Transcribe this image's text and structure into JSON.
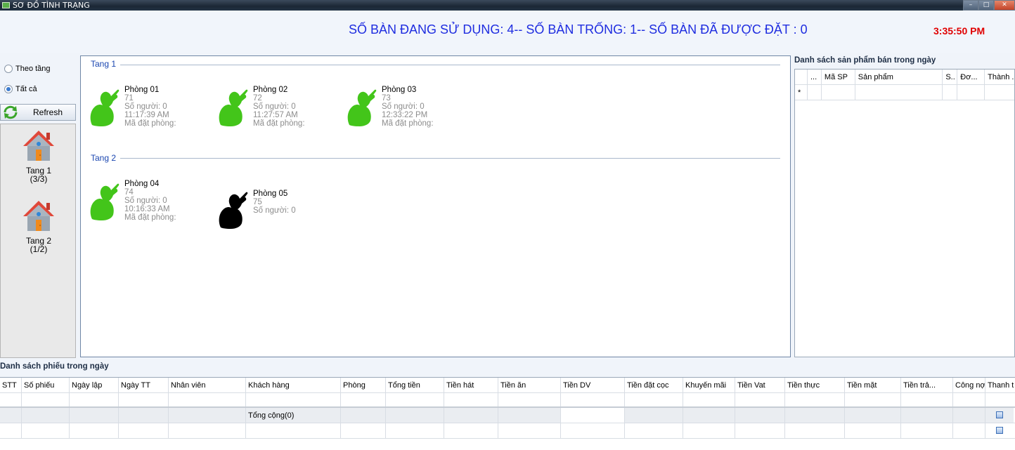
{
  "window": {
    "title": "SƠ ĐỒ TÌNH TRẠNG",
    "buttons": [
      "minimize",
      "maximize",
      "close"
    ]
  },
  "header": {
    "summary": "SỐ BÀN ĐANG SỬ DỤNG: 4-- SỐ BÀN TRỐNG: 1-- SỐ BÀN ĐÃ ĐƯỢC ĐẶT : 0",
    "clock": "3:35:50 PM",
    "summary_color": "#1f2de0",
    "clock_color": "#e00000"
  },
  "left": {
    "radio_by_floor": "Theo tầng",
    "radio_all": "Tất cả",
    "selected": "Tất cả",
    "refresh": "Refresh",
    "floors": [
      {
        "name": "Tang 1",
        "count": "(3/3)"
      },
      {
        "name": "Tang 2",
        "count": "(1/2)"
      }
    ]
  },
  "groups": [
    {
      "label": "Tang 1",
      "rooms": [
        {
          "name": "Phòng 01",
          "code": "71",
          "people": "Số người: 0",
          "time": "11:17:39 AM",
          "booking": "Mã đặt phòng:",
          "status": "occupied"
        },
        {
          "name": "Phòng 02",
          "code": "72",
          "people": "Số người: 0",
          "time": "11:27:57 AM",
          "booking": "Mã đặt phòng:",
          "status": "occupied"
        },
        {
          "name": "Phòng 03",
          "code": "73",
          "people": "Số người: 0",
          "time": "12:33:22 PM",
          "booking": "Mã đặt phòng:",
          "status": "occupied"
        }
      ]
    },
    {
      "label": "Tang 2",
      "rooms": [
        {
          "name": "Phòng 04",
          "code": "74",
          "people": "Số người: 0",
          "time": "10:16:33 AM",
          "booking": "Mã đặt phòng:",
          "status": "occupied"
        },
        {
          "name": "Phòng 05",
          "code": "75",
          "people": "Số người: 0",
          "status": "empty"
        }
      ]
    }
  ],
  "status_colors": {
    "occupied": "#43c51a",
    "empty": "#000000"
  },
  "products": {
    "title": "Danh sách sản phẩm bán trong ngày",
    "columns": [
      "...",
      "Mã SP",
      "Sản phẩm",
      "S..",
      "Đơ...",
      "Thành ..."
    ],
    "new_row_marker": "*"
  },
  "bills": {
    "title": "Danh sách phiếu trong ngày",
    "columns": [
      "STT",
      "Số phiếu",
      "Ngày lập",
      "Ngày TT",
      "Nhân viên",
      "Khách hàng",
      "Phòng",
      "Tổng tiền",
      "Tiền hát",
      "Tiền ăn",
      "Tiền DV",
      "Tiền đặt cọc",
      "Khuyến mãi",
      "Tiền Vat",
      "Tiền thực",
      "Tiền mặt",
      "Tiền trả...",
      "Công nợ",
      "Thanh t..."
    ],
    "total_label": "Tổng cộng(0)"
  }
}
